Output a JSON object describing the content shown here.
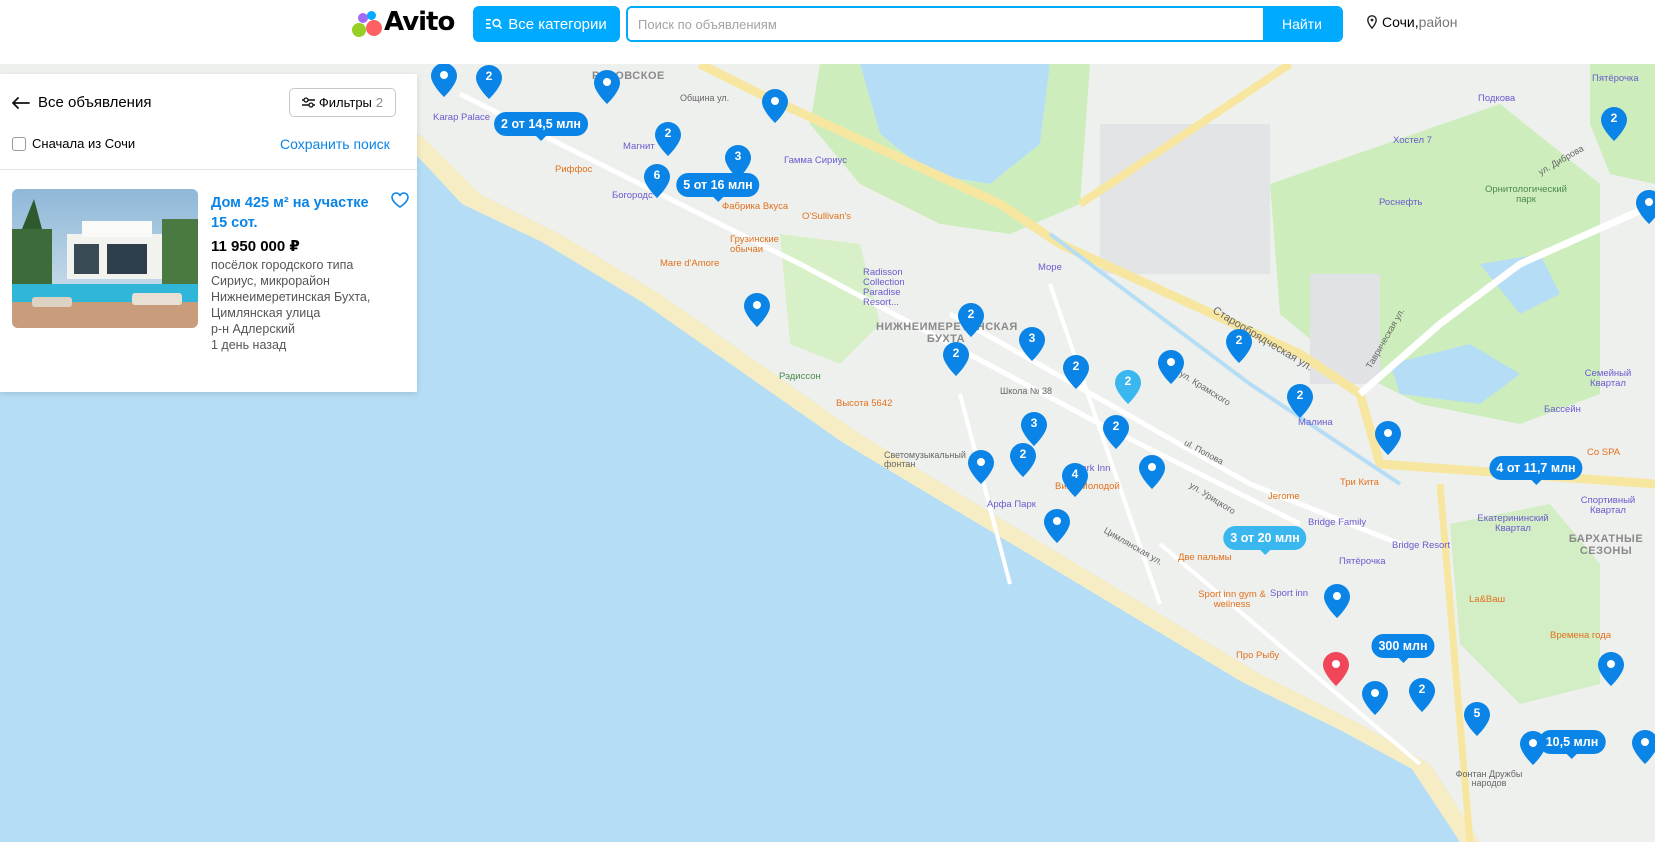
{
  "header": {
    "logo_text": "Avito",
    "categories_button": "Все категории",
    "search_placeholder": "Поиск по объявлениям",
    "search_button": "Найти",
    "location_city": "Сочи,",
    "location_district": " район"
  },
  "panel": {
    "back_label": "Все объявления",
    "filters_label": "Фильтры",
    "filters_count": "2",
    "checkbox_label": "Сначала из Сочи",
    "save_search": "Сохранить поиск"
  },
  "listing": {
    "title": "Дом 425 м² на участке 15 сот.",
    "price": "11 950 000 ₽",
    "address_lines": [
      "посёлок городского типа",
      "Сириус, микрорайон",
      "Нижнеимеретинская Бухта,",
      "Цимлянская улица",
      "р-н Адлерский",
      "1 день назад"
    ]
  },
  "map": {
    "colors": {
      "sea": "#b5ddf5",
      "beach": "#f6edc5",
      "park": "#cdeebc",
      "road": "#f7e6a0",
      "pin": "#0a84e6",
      "pin_light": "#3bb7f0",
      "pin_selected": "#f0465a"
    },
    "labels": [
      {
        "text": "РАСОВСКОЕ",
        "type": "area"
      },
      {
        "text": "Община ул.",
        "type": "street"
      },
      {
        "text": "Karap Palace",
        "type": "poi"
      },
      {
        "text": "Магнит",
        "type": "poi"
      },
      {
        "text": "Риффос",
        "type": "food"
      },
      {
        "text": "Гамма Сириус",
        "type": "poi"
      },
      {
        "text": "Богородс",
        "type": "poi"
      },
      {
        "text": "Фабрика Вкуса",
        "type": "food"
      },
      {
        "text": "O'Sullivan's",
        "type": "food"
      },
      {
        "text": "Грузинские обычаи",
        "type": "food"
      },
      {
        "text": "Mare d'Amore",
        "type": "food"
      },
      {
        "text": "Radisson Collection Paradise Resort...",
        "type": "poi"
      },
      {
        "text": "Море",
        "type": "poi"
      },
      {
        "text": "НИЖНЕИМЕРЕТИНСКАЯ БУХТА",
        "type": "area"
      },
      {
        "text": "Рэдиссон",
        "type": "green"
      },
      {
        "text": "Высота 5642",
        "type": "food"
      },
      {
        "text": "Школа № 38",
        "type": "street"
      },
      {
        "text": "Светомузыкальный фонтан",
        "type": "street"
      },
      {
        "text": "ul. Попова",
        "type": "street"
      },
      {
        "text": "ул. Урицкого",
        "type": "street"
      },
      {
        "text": "ул. Крамского",
        "type": "street"
      },
      {
        "text": "Старообрядческая ул.",
        "type": "street"
      },
      {
        "text": "Таврическая ул.",
        "type": "street"
      },
      {
        "text": "Цимлянская ул.",
        "type": "street"
      },
      {
        "text": "Арфа Парк",
        "type": "poi"
      },
      {
        "text": "Вино Молодой",
        "type": "food"
      },
      {
        "text": "Park Inn",
        "type": "poi"
      },
      {
        "text": "Малина",
        "type": "poi"
      },
      {
        "text": "Три Кита",
        "type": "food"
      },
      {
        "text": "Jerome",
        "type": "food"
      },
      {
        "text": "Bridge Family",
        "type": "poi"
      },
      {
        "text": "Bridge Resort",
        "type": "poi"
      },
      {
        "text": "Пятёрочка",
        "type": "poi"
      },
      {
        "text": "Две пальмы",
        "type": "food"
      },
      {
        "text": "Sport inn gym & wellness",
        "type": "food"
      },
      {
        "text": "Sport inn",
        "type": "poi"
      },
      {
        "text": "Про Рыбу",
        "type": "food"
      },
      {
        "text": "Хостел 7",
        "type": "poi"
      },
      {
        "text": "Роснефть",
        "type": "poi"
      },
      {
        "text": "Орнитологический парк",
        "type": "green"
      },
      {
        "text": "Пятёрочка",
        "type": "poi"
      },
      {
        "text": "Подкова",
        "type": "poi"
      },
      {
        "text": "ул. Диброва",
        "type": "street"
      },
      {
        "text": "Семейный Квартал",
        "type": "poi"
      },
      {
        "text": "Бассейн",
        "type": "poi"
      },
      {
        "text": "Спортивный Квартал",
        "type": "poi"
      },
      {
        "text": "Екатерининский Квартал",
        "type": "poi"
      },
      {
        "text": "БАРХАТНЫЕ СЕЗОНЫ",
        "type": "area"
      },
      {
        "text": "La&Ваш",
        "type": "food"
      },
      {
        "text": "Времена года",
        "type": "food"
      },
      {
        "text": "Фонтан Дружбы народов",
        "type": "street"
      },
      {
        "text": "Со SPA",
        "type": "food"
      }
    ],
    "count_pins": [
      "2",
      "2",
      "3",
      "6",
      "2",
      "2",
      "3",
      "2",
      "2",
      "2",
      "3",
      "2",
      "2",
      "4",
      "2",
      "5",
      "2",
      "2"
    ],
    "single_pins": 16,
    "price_pills": [
      {
        "text": "2 от 14,5 млн",
        "light": false
      },
      {
        "text": "5 от 16 млн",
        "light": false
      },
      {
        "text": "4 от 11,7 млн",
        "light": false
      },
      {
        "text": "3 от 20 млн",
        "light": true
      },
      {
        "text": "300 млн",
        "light": false
      },
      {
        "text": "10,5 млн",
        "light": false
      }
    ]
  }
}
